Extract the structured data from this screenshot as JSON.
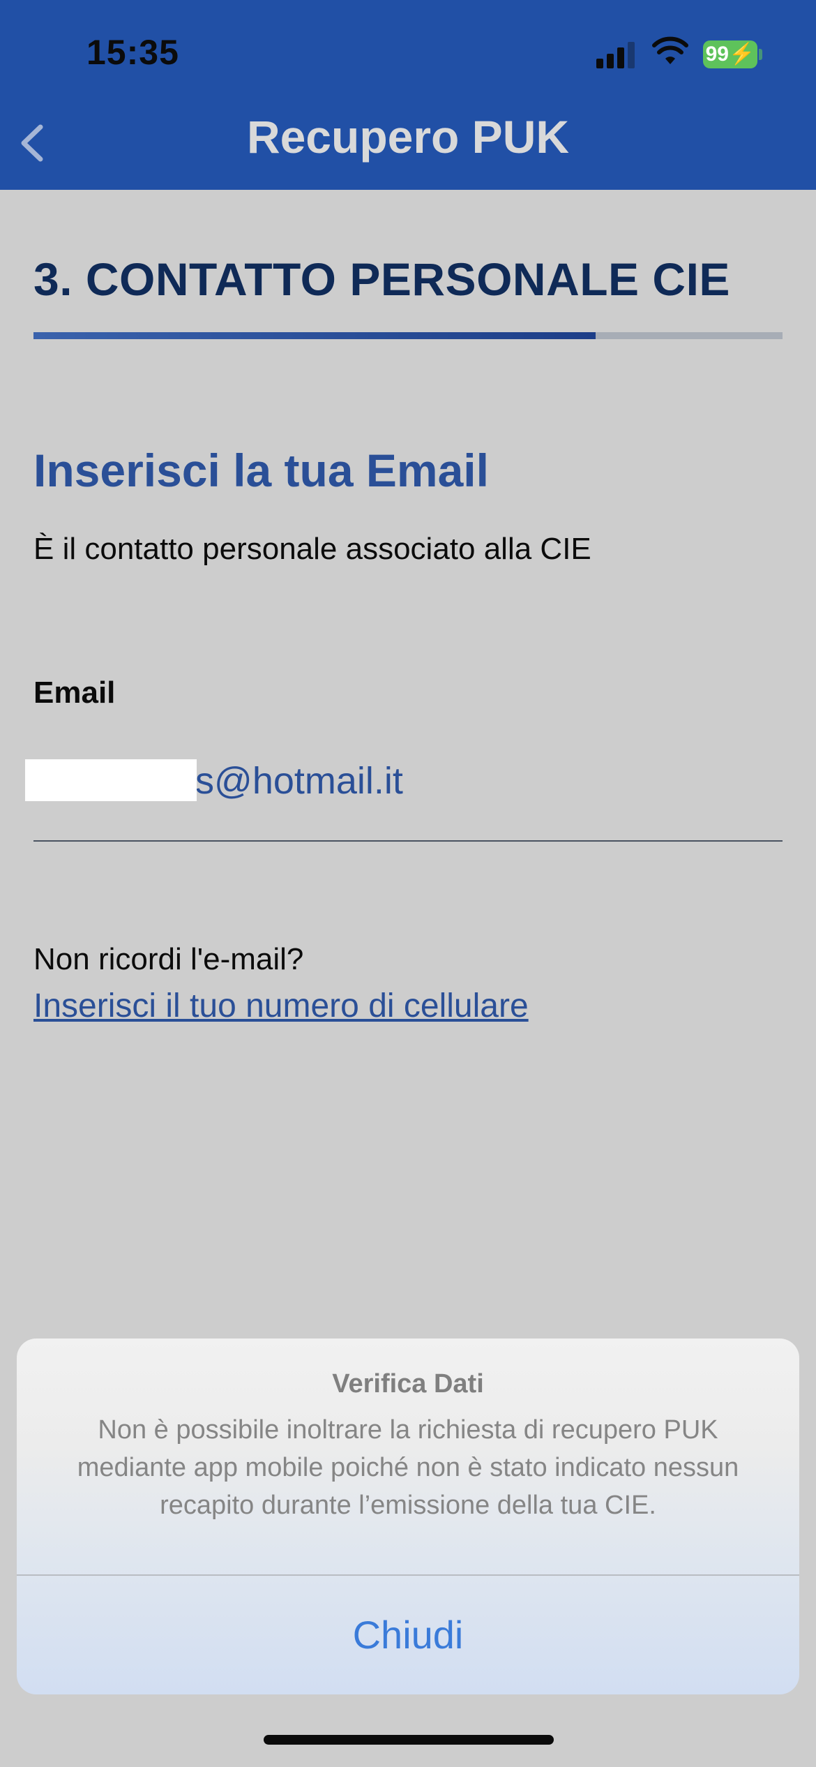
{
  "status_bar": {
    "time": "15:35",
    "battery": "99"
  },
  "header": {
    "title": "Recupero PUK",
    "back_icon": "chevron-left-icon"
  },
  "step": {
    "title": "3. CONTATTO PERSONALE CIE",
    "progress_fraction": 0.75
  },
  "section": {
    "title": "Inserisci la tua Email",
    "subtitle": "È il contatto personale associato alla CIE"
  },
  "email_field": {
    "label": "Email",
    "value": "s@hotmail.it"
  },
  "alternative": {
    "question": "Non ricordi l'e-mail?",
    "link_label": "Inserisci il tuo numero di cellulare"
  },
  "dialog": {
    "title": "Verifica Dati",
    "message": "Non è possibile inoltrare la richiesta di recupero PUK mediante app mobile poiché non è stato indicato nessun recapito durante l’emissione della tua CIE.",
    "button_label": "Chiudi"
  },
  "colors": {
    "brand_blue": "#2150a6",
    "link_blue": "#2a4f97",
    "dialog_button": "#3a7bd9",
    "battery_green": "#5ec25b"
  }
}
